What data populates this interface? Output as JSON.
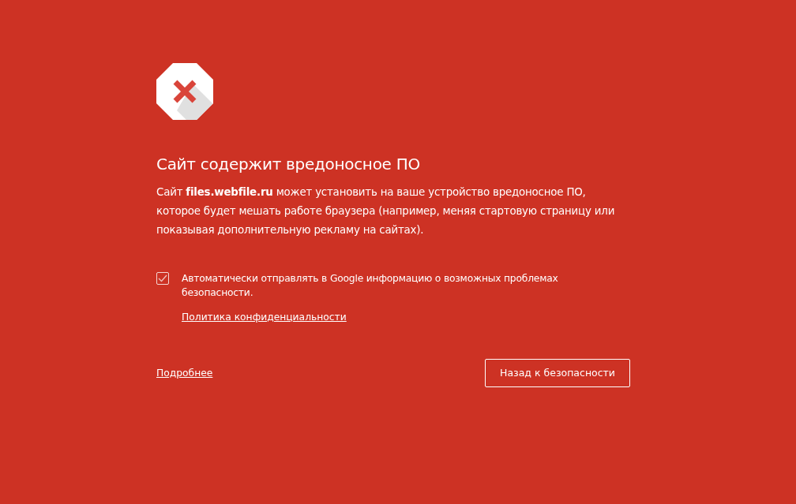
{
  "heading": "Сайт содержит вредоносное ПО",
  "description": "Сайт **files.webfile.ru** может установить на ваше устройство вредоносное ПО, которое будет мешать работе браузера (например, меняя стартовую страницу или показывая дополнительную рекламу на сайтах).",
  "report_option": {
    "label": "Автоматически отправлять в Google информацию о возможных проблемах безопасности.",
    "checked": true,
    "link": "Политика конфиденциальности"
  },
  "details_link": "Подробнее",
  "back_button": "Назад к безопасности"
}
